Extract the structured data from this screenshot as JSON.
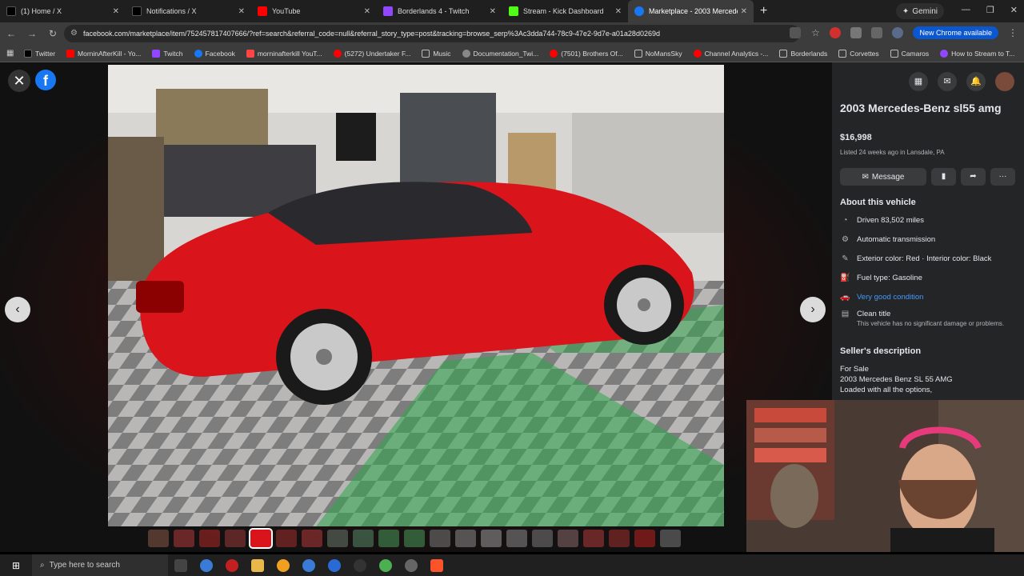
{
  "browser": {
    "tabs": [
      {
        "label": "(1) Home / X",
        "color": "#000000",
        "active": false
      },
      {
        "label": "Notifications / X",
        "color": "#000000",
        "active": false
      },
      {
        "label": "YouTube",
        "color": "#ff0000",
        "active": false
      },
      {
        "label": "Borderlands 4 - Twitch",
        "color": "#9146ff",
        "active": false
      },
      {
        "label": "Stream - Kick Dashboard",
        "color": "#53fc18",
        "active": false
      },
      {
        "label": "Marketplace - 2003 Mercedes-",
        "color": "#1877f2",
        "active": true
      }
    ],
    "gemini_label": "Gemini",
    "url": "facebook.com/marketplace/item/752457817407666/?ref=search&referral_code=null&referral_story_type=post&tracking=browse_serp%3Ac3dda744-78c9-47e2-9d7e-a01a28d0269d",
    "new_chrome_label": "New Chrome available",
    "bookmarks": [
      {
        "label": "Twitter",
        "color": "#000000"
      },
      {
        "label": "MorninAfterKill - Yo...",
        "color": "#ff0000"
      },
      {
        "label": "Twitch",
        "color": "#9146ff"
      },
      {
        "label": "Facebook",
        "color": "#1877f2"
      },
      {
        "label": "morninafterkill YouT...",
        "color": "#ff4444"
      },
      {
        "label": "(5272) Undertaker F...",
        "color": "#ff0000"
      },
      {
        "label": "Music",
        "color": "#888888"
      },
      {
        "label": "Documentation_Twi...",
        "color": "#888888"
      },
      {
        "label": "(7501) Brothers Of...",
        "color": "#ff0000"
      },
      {
        "label": "NoMansSky",
        "color": "#888888"
      },
      {
        "label": "Channel Analytics -...",
        "color": "#ff0000"
      },
      {
        "label": "Borderlands",
        "color": "#888888"
      },
      {
        "label": "Corvettes",
        "color": "#888888"
      },
      {
        "label": "Camaros",
        "color": "#888888"
      },
      {
        "label": "How to Stream to T...",
        "color": "#9146ff"
      }
    ]
  },
  "viewer": {
    "thumbnail_count": 21,
    "selected_thumbnail": 4
  },
  "listing": {
    "title": "2003 Mercedes-Benz sl55 amg",
    "price": "$16,998",
    "listed": "Listed 24 weeks ago in Lansdale, PA",
    "message_label": "Message",
    "about_heading": "About this vehicle",
    "attributes": [
      {
        "icon": "gauge-icon",
        "text": "Driven 83,502 miles"
      },
      {
        "icon": "transmission-icon",
        "text": "Automatic transmission"
      },
      {
        "icon": "paint-icon",
        "text": "Exterior color: Red · Interior color: Black"
      },
      {
        "icon": "fuel-icon",
        "text": "Fuel type: Gasoline"
      },
      {
        "icon": "car-icon",
        "text": "Very good condition"
      },
      {
        "icon": "document-icon",
        "text": "Clean title",
        "sub": "This vehicle has no significant damage or problems."
      }
    ],
    "seller_heading": "Seller's description",
    "description": [
      "For Sale",
      "2003 Mercedes Benz SL 55 AMG",
      "Loaded with all the options,"
    ]
  },
  "taskbar": {
    "search_placeholder": "Type here to search"
  }
}
